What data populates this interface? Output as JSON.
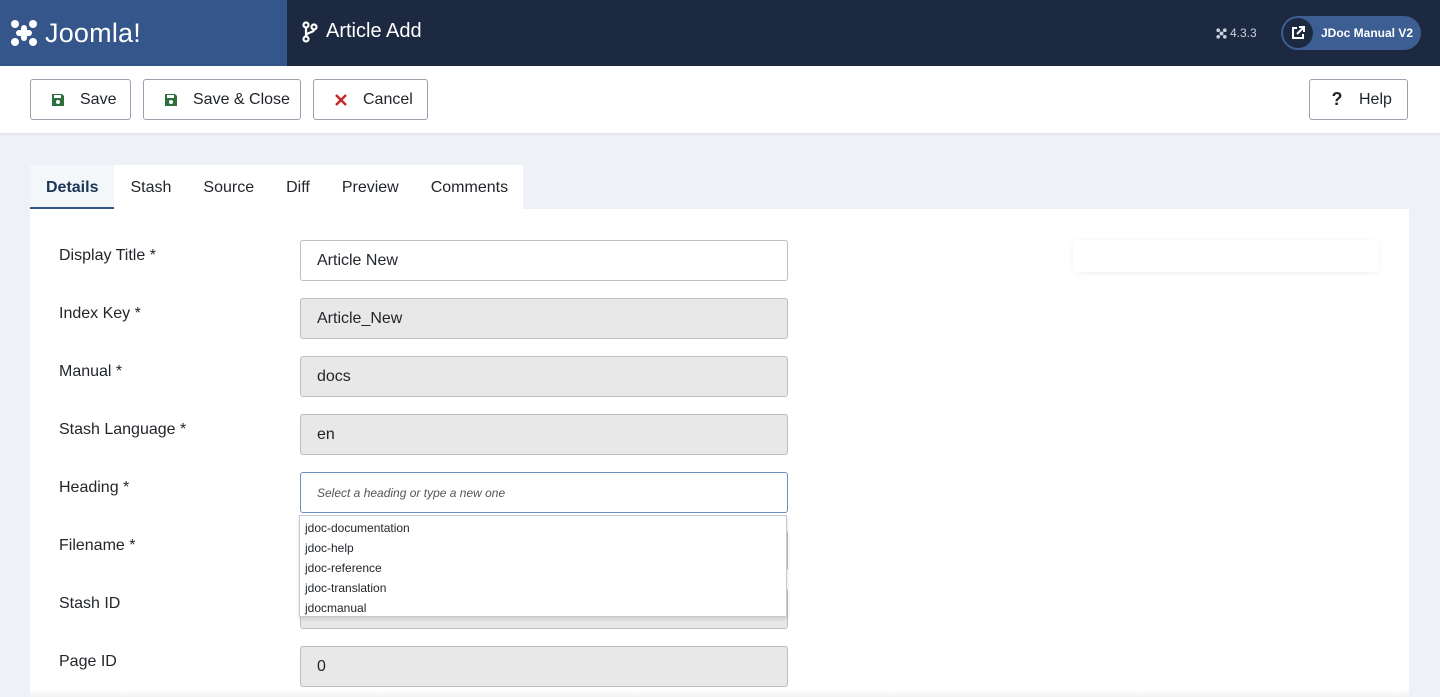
{
  "header": {
    "logo_text": "Joomla!",
    "page_title": "Article Add",
    "version": "4.3.3",
    "site_button_label": "JDoc Manual V2"
  },
  "toolbar": {
    "save_label": "Save",
    "save_close_label": "Save & Close",
    "cancel_label": "Cancel",
    "help_label": "Help"
  },
  "tabs": [
    "Details",
    "Stash",
    "Source",
    "Diff",
    "Preview",
    "Comments"
  ],
  "form": {
    "display_title": {
      "label": "Display Title *",
      "value": "Article New"
    },
    "index_key": {
      "label": "Index Key *",
      "value": "Article_New"
    },
    "manual": {
      "label": "Manual *",
      "value": "docs"
    },
    "stash_language": {
      "label": "Stash Language *",
      "value": "en"
    },
    "heading": {
      "label": "Heading *",
      "placeholder": "Select a heading or type a new one"
    },
    "filename": {
      "label": "Filename *"
    },
    "stash_id": {
      "label": "Stash ID"
    },
    "page_id": {
      "label": "Page ID",
      "value": "0"
    }
  },
  "heading_options": [
    "jdoc-documentation",
    "jdoc-help",
    "jdoc-reference",
    "jdoc-translation",
    "jdocmanual"
  ],
  "colors": {
    "header_bg": "#1c2941",
    "logo_bg": "#34568a",
    "save_icon": "#2f6e3e",
    "cancel_icon": "#c52827"
  }
}
